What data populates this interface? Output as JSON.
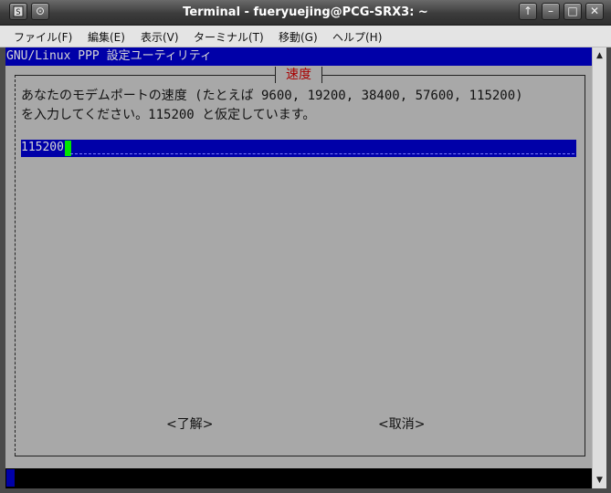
{
  "window": {
    "title": "Terminal - fueryuejing@PCG-SRX3: ~",
    "menu_glyph": "⊙",
    "up_glyph": "↑",
    "minimize_glyph": "–",
    "maximize_glyph": "□",
    "close_glyph": "✕"
  },
  "menubar": {
    "items": [
      {
        "label": "ファイル(F)"
      },
      {
        "label": "編集(E)"
      },
      {
        "label": "表示(V)"
      },
      {
        "label": "ターミナル(T)"
      },
      {
        "label": "移動(G)"
      },
      {
        "label": "ヘルプ(H)"
      }
    ]
  },
  "app": {
    "header": "GNU/Linux PPP 設定ユーティリティ"
  },
  "dialog": {
    "title": "速度",
    "prompt_line1": "あなたのモデムポートの速度 (たとえば 9600, 19200, 38400, 57600, 115200)",
    "prompt_line2": "を入力してください。115200 と仮定しています。",
    "input_value": "115200",
    "ok_label": "<了解>",
    "cancel_label": "<取消>"
  },
  "scrollbar": {
    "up_glyph": "▲",
    "down_glyph": "▼"
  },
  "colors": {
    "terminal_bg": "#a8a8a8",
    "ncurses_blue": "#0000a8",
    "title_red": "#a80000",
    "cursor_green": "#00e600"
  }
}
